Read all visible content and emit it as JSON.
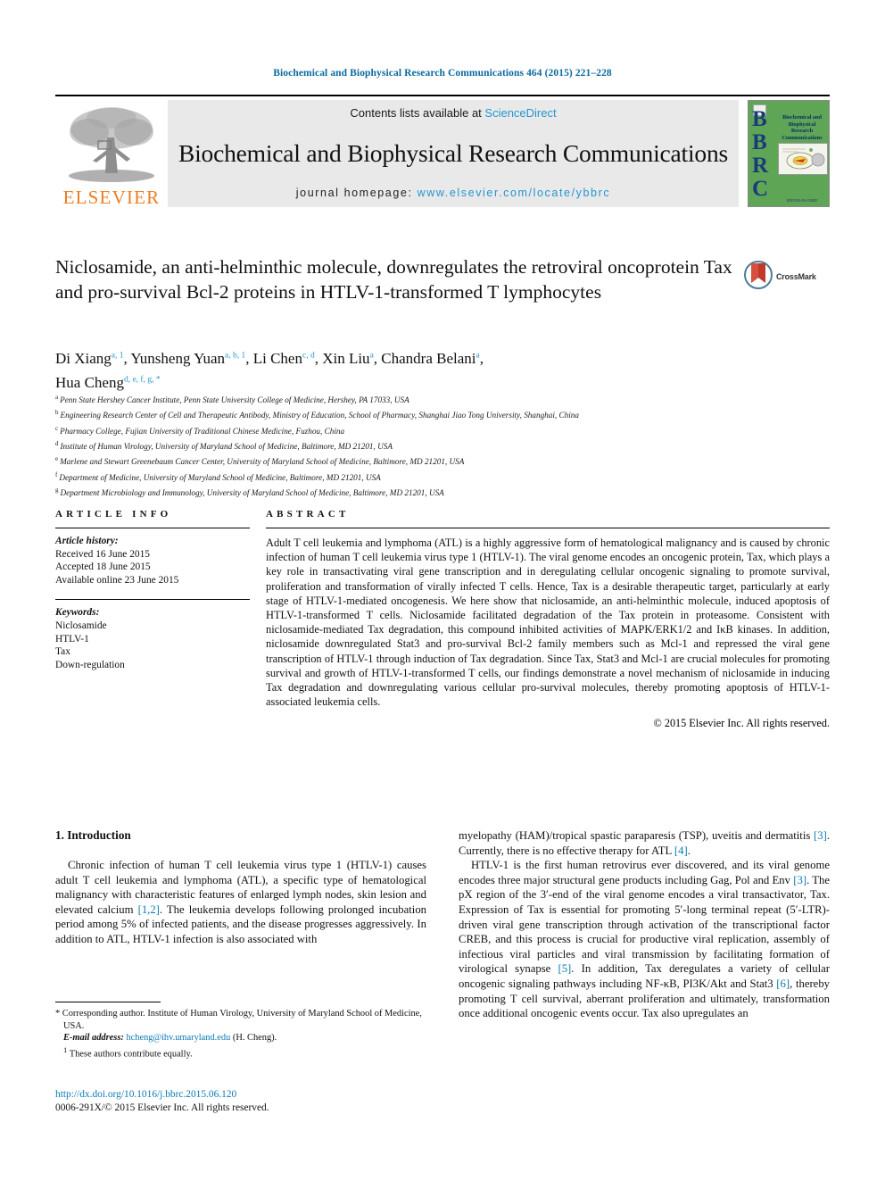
{
  "running_head": "Biochemical and Biophysical Research Communications 464 (2015) 221–228",
  "masthead": {
    "contents_prefix": "Contents lists available at ",
    "sciencedirect": "ScienceDirect",
    "journal_title": "Biochemical and Biophysical Research Communications",
    "homepage_prefix": "journal homepage: ",
    "homepage_url": "www.elsevier.com/locate/ybbrc",
    "elsevier_wordmark": "ELSEVIER",
    "cover": {
      "letters": "BBRC",
      "title_lines": [
        "Biochemical and",
        "Biophysical",
        "Research",
        "Communications"
      ],
      "footer": "EDITOR-IN-CHIEF"
    },
    "accent_link_color": "#2596cf",
    "elsevier_orange": "#ef7d22",
    "cover_green": "#5fa556",
    "cover_blue": "#1b3a7a"
  },
  "article": {
    "title": "Niclosamide, an anti-helminthic molecule, downregulates the retroviral oncoprotein Tax and pro-survival Bcl-2 proteins in HTLV-1-transformed T lymphocytes",
    "crossmark_label": "CrossMark",
    "authors": [
      {
        "name": "Di Xiang",
        "sup": "a, 1",
        "sep": ", "
      },
      {
        "name": "Yunsheng Yuan",
        "sup": "a, b, 1",
        "sep": ", "
      },
      {
        "name": "Li Chen",
        "sup": "c, d",
        "sep": ", "
      },
      {
        "name": "Xin Liu",
        "sup": "a",
        "sep": ", "
      },
      {
        "name": "Chandra Belani",
        "sup": "a",
        "sep": ", "
      },
      {
        "name": "Hua Cheng",
        "sup": "d, e, f, g, *",
        "sep": ""
      }
    ],
    "affiliations": [
      {
        "mark": "a",
        "text": "Penn State Hershey Cancer Institute, Penn State University College of Medicine, Hershey, PA 17033, USA"
      },
      {
        "mark": "b",
        "text": "Engineering Research Center of Cell and Therapeutic Antibody, Ministry of Education, School of Pharmacy, Shanghai Jiao Tong University, Shanghai, China"
      },
      {
        "mark": "c",
        "text": "Pharmacy College, Fujian University of Traditional Chinese Medicine, Fuzhou, China"
      },
      {
        "mark": "d",
        "text": "Institute of Human Virology, University of Maryland School of Medicine, Baltimore, MD 21201, USA"
      },
      {
        "mark": "e",
        "text": "Marlene and Stewart Greenebaum Cancer Center, University of Maryland School of Medicine, Baltimore, MD 21201, USA"
      },
      {
        "mark": "f",
        "text": "Department of Medicine, University of Maryland School of Medicine, Baltimore, MD 21201, USA"
      },
      {
        "mark": "g",
        "text": "Department Microbiology and Immunology, University of Maryland School of Medicine, Baltimore, MD 21201, USA"
      }
    ]
  },
  "article_info": {
    "heading": "ARTICLE INFO",
    "history_label": "Article history:",
    "history": [
      "Received 16 June 2015",
      "Accepted 18 June 2015",
      "Available online 23 June 2015"
    ],
    "keywords_label": "Keywords:",
    "keywords": [
      "Niclosamide",
      "HTLV-1",
      "Tax",
      "Down-regulation"
    ]
  },
  "abstract": {
    "heading": "ABSTRACT",
    "text": "Adult T cell leukemia and lymphoma (ATL) is a highly aggressive form of hematological malignancy and is caused by chronic infection of human T cell leukemia virus type 1 (HTLV-1). The viral genome encodes an oncogenic protein, Tax, which plays a key role in transactivating viral gene transcription and in deregulating cellular oncogenic signaling to promote survival, proliferation and transformation of virally infected T cells. Hence, Tax is a desirable therapeutic target, particularly at early stage of HTLV-1-mediated oncogenesis. We here show that niclosamide, an anti-helminthic molecule, induced apoptosis of HTLV-1-transformed T cells. Niclosamide facilitated degradation of the Tax protein in proteasome. Consistent with niclosamide-mediated Tax degradation, this compound inhibited activities of MAPK/ERK1/2 and IκB kinases. In addition, niclosamide downregulated Stat3 and pro-survival Bcl-2 family members such as Mcl-1 and repressed the viral gene transcription of HTLV-1 through induction of Tax degradation. Since Tax, Stat3 and Mcl-1 are crucial molecules for promoting survival and growth of HTLV-1-transformed T cells, our findings demonstrate a novel mechanism of niclosamide in inducing Tax degradation and downregulating various cellular pro-survival molecules, thereby promoting apoptosis of HTLV-1-associated leukemia cells.",
    "copyright": "© 2015 Elsevier Inc. All rights reserved."
  },
  "introduction": {
    "heading": "1. Introduction",
    "left_paragraph_1_a": "Chronic infection of human T cell leukemia virus type 1 (HTLV-1) causes adult T cell leukemia and lymphoma (ATL), a specific type of hematological malignancy with characteristic features of enlarged lymph nodes, skin lesion and elevated calcium ",
    "left_ref_1": "[1,2]",
    "left_paragraph_1_b": ". The leukemia develops following prolonged incubation period among 5% of infected patients, and the disease progresses aggressively. In addition to ATL, HTLV-1 infection is also associated with",
    "right_paragraph_1_a": "myelopathy (HAM)/tropical spastic paraparesis (TSP), uveitis and dermatitis ",
    "right_ref_3a": "[3]",
    "right_paragraph_1_b": ". Currently, there is no effective therapy for ATL ",
    "right_ref_4": "[4]",
    "right_paragraph_1_c": ".",
    "right_paragraph_2_a": "HTLV-1 is the first human retrovirus ever discovered, and its viral genome encodes three major structural gene products including Gag, Pol and Env ",
    "right_ref_3b": "[3]",
    "right_paragraph_2_b": ". The pX region of the 3′-end of the viral genome encodes a viral transactivator, Tax. Expression of Tax is essential for promoting 5′-long terminal repeat (5′-LTR)-driven viral gene transcription through activation of the transcriptional factor CREB, and this process is crucial for productive viral replication, assembly of infectious viral particles and viral transmission by facilitating formation of virological synapse ",
    "right_ref_5": "[5]",
    "right_paragraph_2_c": ". In addition, Tax deregulates a variety of cellular oncogenic signaling pathways including NF-κB, PI3K/Akt and Stat3 ",
    "right_ref_6": "[6]",
    "right_paragraph_2_d": ", thereby promoting T cell survival, aberrant proliferation and ultimately, transformation once additional oncogenic events occur. Tax also upregulates an"
  },
  "footnotes": {
    "corresponding": "* Corresponding author. Institute of Human Virology, University of Maryland School of Medicine, USA.",
    "email_label": "E-mail address:",
    "email": "hcheng@ihv.umaryland.edu",
    "email_suffix": "(H. Cheng).",
    "equal_contrib_mark": "1",
    "equal_contrib": "These authors contribute equally.",
    "doi": "http://dx.doi.org/10.1016/j.bbrc.2015.06.120",
    "issn_copyright": "0006-291X/© 2015 Elsevier Inc. All rights reserved."
  }
}
